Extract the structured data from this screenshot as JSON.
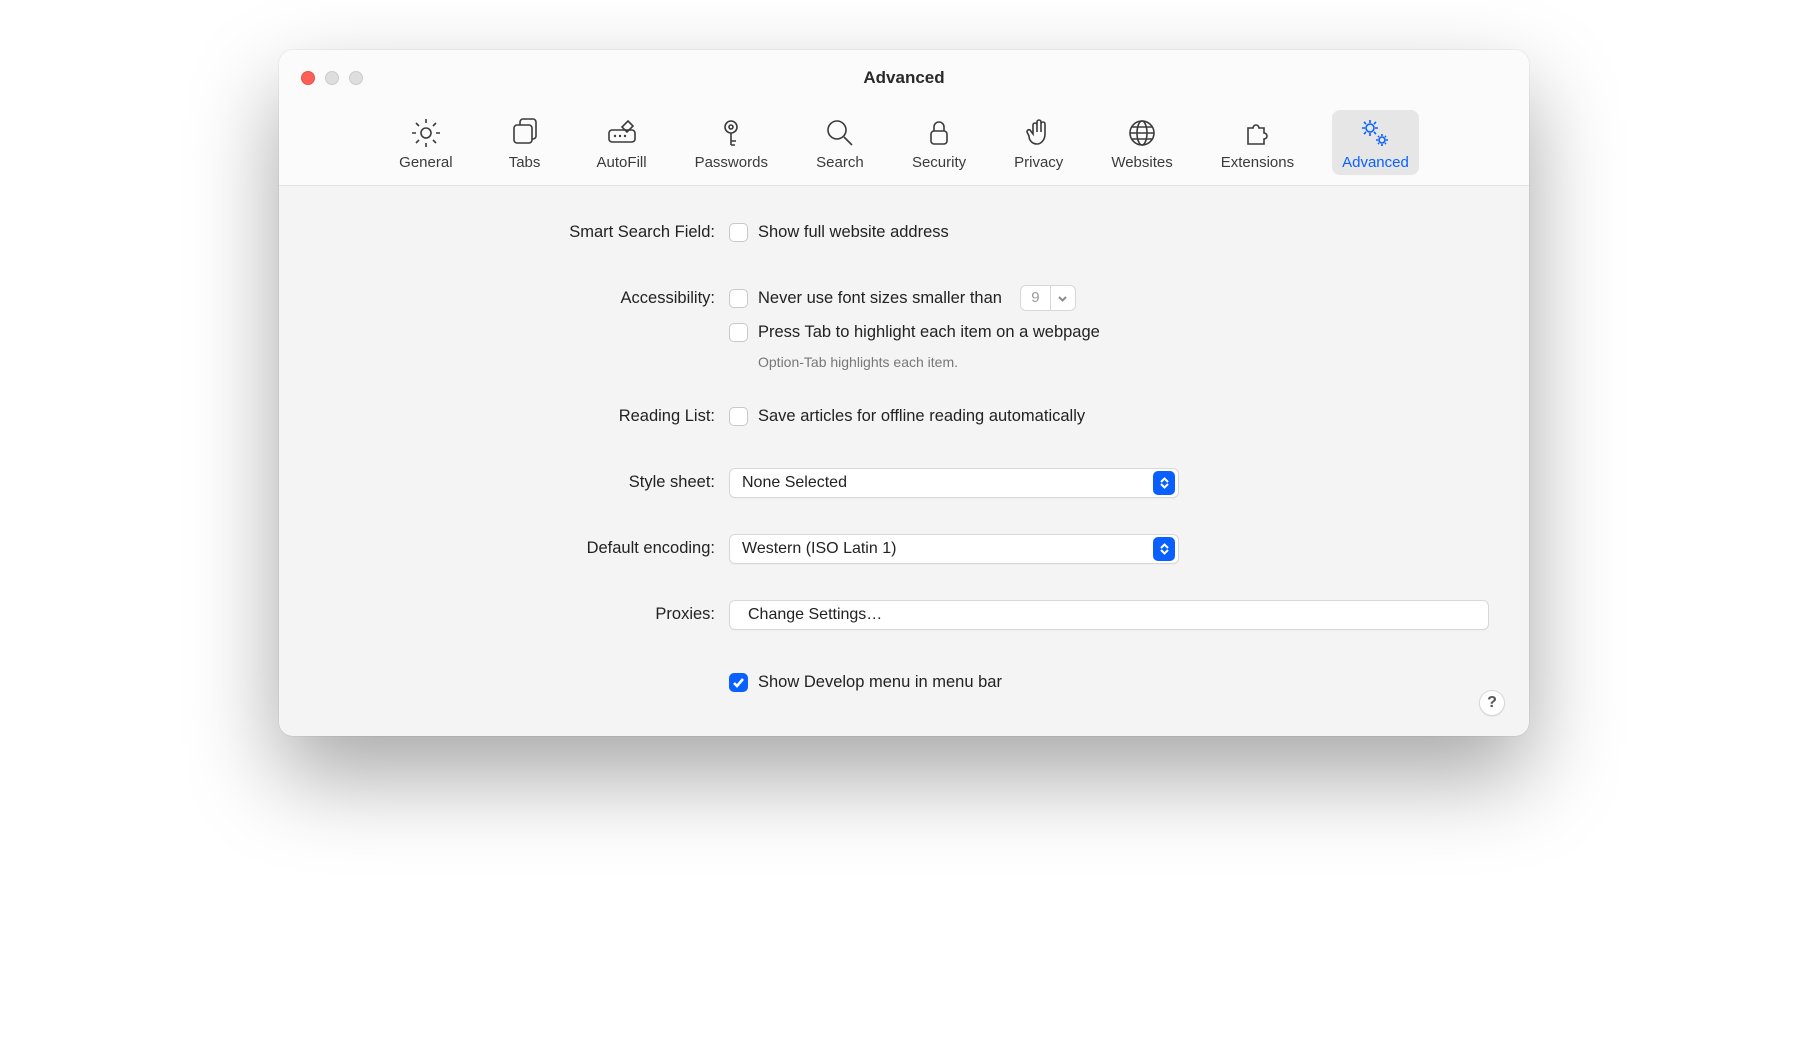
{
  "window": {
    "title": "Advanced"
  },
  "tabs": [
    {
      "id": "general",
      "label": "General"
    },
    {
      "id": "tabs",
      "label": "Tabs"
    },
    {
      "id": "autofill",
      "label": "AutoFill"
    },
    {
      "id": "passwords",
      "label": "Passwords"
    },
    {
      "id": "search",
      "label": "Search"
    },
    {
      "id": "security",
      "label": "Security"
    },
    {
      "id": "privacy",
      "label": "Privacy"
    },
    {
      "id": "websites",
      "label": "Websites"
    },
    {
      "id": "extensions",
      "label": "Extensions"
    },
    {
      "id": "advanced",
      "label": "Advanced",
      "active": true
    }
  ],
  "sections": {
    "smart_search": {
      "label": "Smart Search Field:",
      "show_full_address": {
        "label": "Show full website address",
        "checked": false
      }
    },
    "accessibility": {
      "label": "Accessibility:",
      "min_font": {
        "label": "Never use font sizes smaller than",
        "checked": false,
        "value": "9"
      },
      "press_tab": {
        "label": "Press Tab to highlight each item on a webpage",
        "checked": false
      },
      "hint": "Option-Tab highlights each item."
    },
    "reading_list": {
      "label": "Reading List:",
      "save_offline": {
        "label": "Save articles for offline reading automatically",
        "checked": false
      }
    },
    "style_sheet": {
      "label": "Style sheet:",
      "value": "None Selected"
    },
    "default_encoding": {
      "label": "Default encoding:",
      "value": "Western (ISO Latin 1)"
    },
    "proxies": {
      "label": "Proxies:",
      "button": "Change Settings…"
    },
    "develop_menu": {
      "label": "Show Develop menu in menu bar",
      "checked": true
    }
  },
  "help": "?"
}
